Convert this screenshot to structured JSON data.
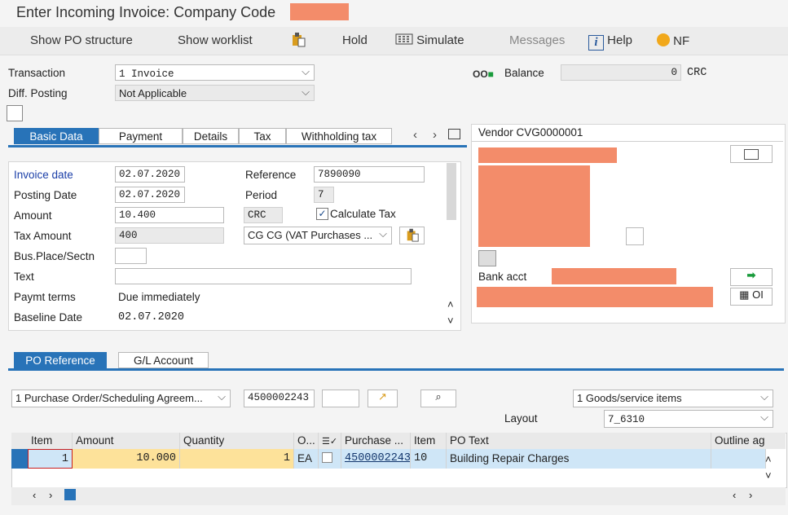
{
  "window": {
    "title": "Enter Incoming Invoice: Company Code"
  },
  "toolbar": {
    "show_po_structure": "Show PO structure",
    "show_worklist": "Show worklist",
    "hold": "Hold",
    "simulate": "Simulate",
    "messages": "Messages",
    "help": "Help",
    "nf": "NF"
  },
  "header": {
    "transaction_label": "Transaction",
    "transaction_value": "1 Invoice",
    "diff_posting_label": "Diff. Posting",
    "diff_posting_value": "Not Applicable",
    "balance_label": "Balance",
    "balance_value": "0",
    "balance_currency": "CRC"
  },
  "tabs": [
    "Basic Data",
    "Payment",
    "Details",
    "Tax",
    "Withholding tax"
  ],
  "basic": {
    "invoice_date_label": "Invoice date",
    "invoice_date": "02.07.2020",
    "reference_label": "Reference",
    "reference": "7890090",
    "posting_date_label": "Posting Date",
    "posting_date": "02.07.2020",
    "period_label": "Period",
    "period": "7",
    "amount_label": "Amount",
    "amount": "10.400",
    "currency": "CRC",
    "calc_tax_label": "Calculate Tax",
    "tax_amount_label": "Tax Amount",
    "tax_amount": "400",
    "tax_code": "CG CG (VAT Purchases ...",
    "bus_place_label": "Bus.Place/Sectn",
    "bus_place": "",
    "text_label": "Text",
    "text": "",
    "paymt_terms_label": "Paymt terms",
    "paymt_terms": "Due immediately",
    "baseline_label": "Baseline Date",
    "baseline_date": "02.07.2020"
  },
  "vendor": {
    "title": "Vendor CVG0000001",
    "bank_acct_label": "Bank acct",
    "oi_label": "OI"
  },
  "lower_tabs": [
    "PO Reference",
    "G/L Account"
  ],
  "po": {
    "ref_type": "1 Purchase Order/Scheduling Agreem...",
    "po_number": "4500002243",
    "goods_items": "1 Goods/service items",
    "layout_label": "Layout",
    "layout_value": "7_6310"
  },
  "table": {
    "headers": [
      "Item",
      "Amount",
      "Quantity",
      "O...",
      "",
      "Purchase ...",
      "Item",
      "PO Text",
      "Outline ag"
    ],
    "rows": [
      {
        "item": "1",
        "amount": "10.000",
        "quantity": "1",
        "unit": "EA",
        "po": "4500002243",
        "po_item": "10",
        "po_text": "Building Repair Charges"
      }
    ]
  }
}
